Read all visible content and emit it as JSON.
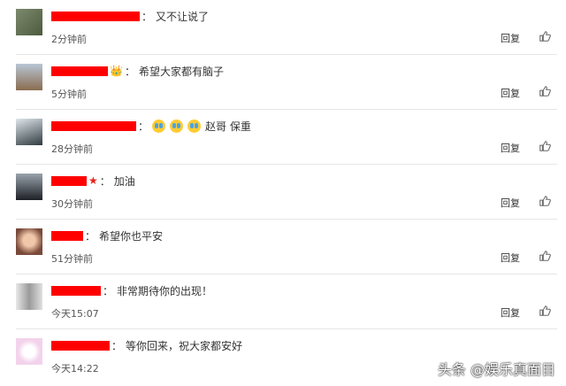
{
  "comments": [
    {
      "text": "又不让说了",
      "time": "2分钟前",
      "reply": "回复"
    },
    {
      "text": "希望大家都有脑子",
      "time": "5分钟前",
      "reply": "回复",
      "badge": "👑"
    },
    {
      "text": "赵哥 保重",
      "time": "28分钟前",
      "reply": "回复",
      "emoji_count": 3
    },
    {
      "text": "加油",
      "time": "30分钟前",
      "reply": "回复",
      "badge": "★"
    },
    {
      "text": "希望你也平安",
      "time": "51分钟前",
      "reply": "回复"
    },
    {
      "text": "非常期待你的出现！",
      "time": "今天15:07",
      "reply": "回复"
    },
    {
      "text": "等你回来，祝大家都安好",
      "time": "今天14:22",
      "reply": ""
    }
  ],
  "watermark": "头条 @娱乐真面目",
  "colors": {
    "redaction": "#ff0000",
    "badge_star": "#e2231a",
    "badge_crown": "#f5a623"
  }
}
